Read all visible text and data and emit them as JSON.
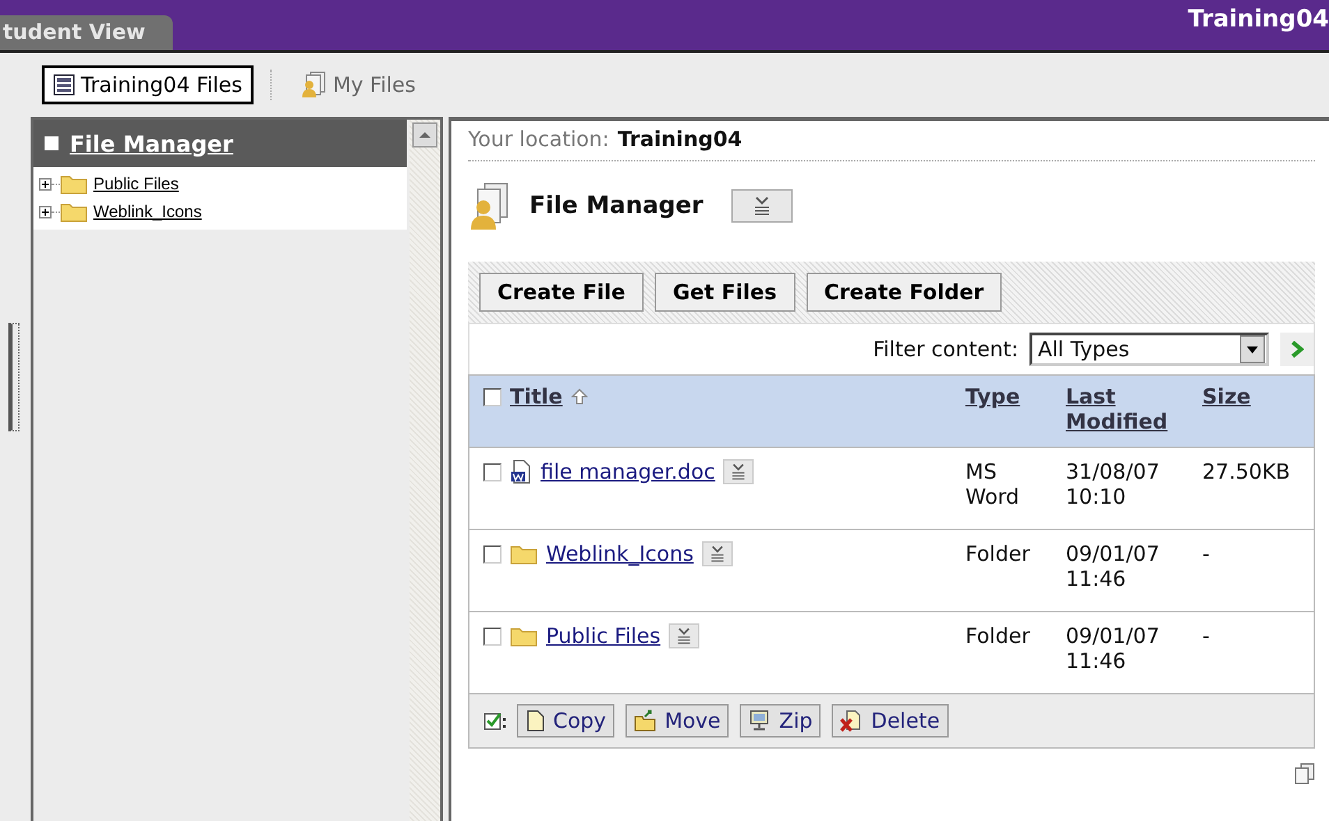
{
  "top_bar": {
    "tab": "tudent View",
    "site_title": "Training04"
  },
  "toolbar": [
    {
      "label": "Training04 Files",
      "selected": true,
      "kind": "files"
    },
    {
      "label": "My Files",
      "selected": false,
      "kind": "myfiles"
    }
  ],
  "sidebar": {
    "title": "File Manager",
    "tree": [
      {
        "label": "Public Files",
        "expanded": false
      },
      {
        "label": "Weblink_Icons",
        "expanded": false
      }
    ]
  },
  "location": {
    "label": "Your location:",
    "value": "Training04"
  },
  "heading": "File Manager",
  "actions": [
    "Create File",
    "Get Files",
    "Create Folder"
  ],
  "filter": {
    "label": "Filter content:",
    "value": "All Types"
  },
  "table": {
    "select_all_checked": false,
    "columns": [
      "Title",
      "Type",
      "Last Modified",
      "Size"
    ],
    "rows": [
      {
        "kind": "doc",
        "title": "file manager.doc",
        "type": "MS Word",
        "modified": "31/08/07 10:10",
        "size": "27.50KB",
        "checked": false
      },
      {
        "kind": "folder",
        "title": "Weblink_Icons",
        "type": "Folder",
        "modified": "09/01/07 11:46",
        "size": "-",
        "checked": false
      },
      {
        "kind": "folder",
        "title": "Public Files",
        "type": "Folder",
        "modified": "09/01/07 11:46",
        "size": "-",
        "checked": false
      }
    ]
  },
  "bulk_actions": [
    {
      "kind": "copy",
      "label": "Copy"
    },
    {
      "kind": "move",
      "label": "Move"
    },
    {
      "kind": "zip",
      "label": "Zip"
    },
    {
      "kind": "delete",
      "label": "Delete"
    }
  ]
}
